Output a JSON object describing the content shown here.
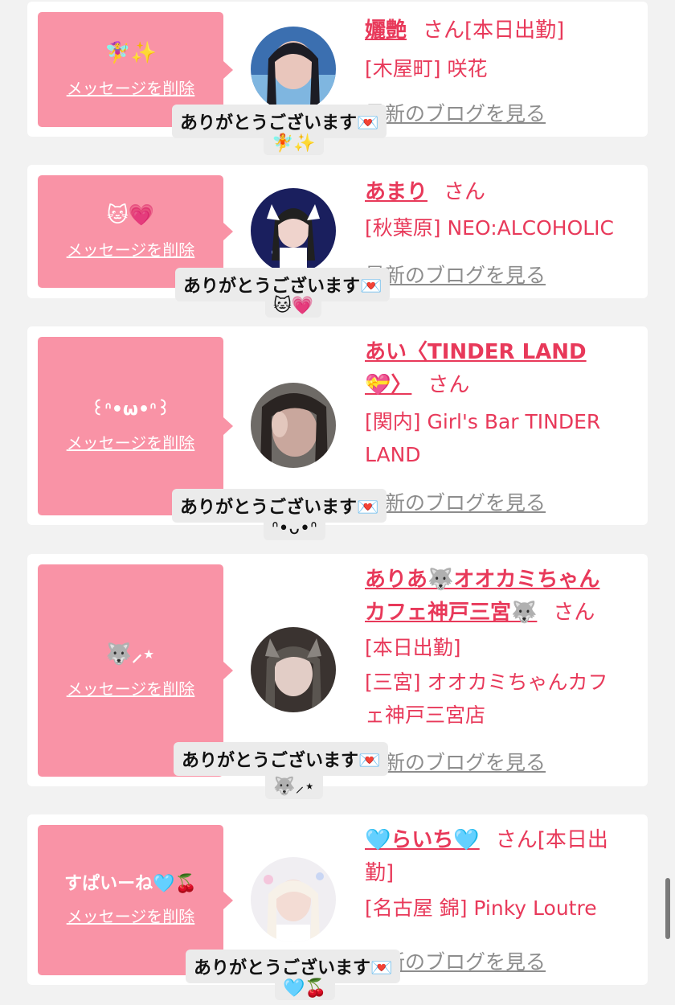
{
  "thanks_text": "ありがとうございます💌",
  "delete_label": "メッセージを削除",
  "blog_label": "最新のブログを見る",
  "san_label": "さん",
  "colors": {
    "bubble": "#f993a6",
    "name": "#e8395a",
    "blog": "#8d8d8d",
    "tooltip_bg": "#ebebeb"
  },
  "cards": [
    {
      "message": "🧚‍♀️✨",
      "name": "孋艶",
      "status": "[本日出勤]",
      "shop": "[木屋町] 咲花",
      "reaction": "🧚✨"
    },
    {
      "message": "🐱💗",
      "name": "あまり",
      "status": "",
      "shop": "[秋葉原] NEO:ALCOHOLIC",
      "reaction": "🐱💗"
    },
    {
      "message": "꒰ᐢ•ω•ᐢ꒱",
      "name_line1": "あい〈TINDER LAND",
      "name_line2": "💝〉",
      "shop_line1": "[関内] Girl's Bar TINDER",
      "shop_line2": "LAND",
      "reaction": "ᐢ•ᴗ•ᐢ"
    },
    {
      "message": "🐺⸝⋆",
      "name_line1": "ありあ🐺オオカミちゃん",
      "name_line2": "カフェ神戸三宮🐺",
      "status": "[本日出勤]",
      "shop_line1": "[三宮] オオカミちゃんカフ",
      "shop_line2": "ェ神戸三宮店",
      "reaction": "🐺⸝⋆"
    },
    {
      "message": "すぱいーね🩵🍒",
      "name": "🩵らいち🩵",
      "status_line1": "[本日出",
      "status_line2": "勤]",
      "shop": "[名古屋 錦] Pinky Loutre",
      "reaction": "🩵🍒"
    }
  ]
}
